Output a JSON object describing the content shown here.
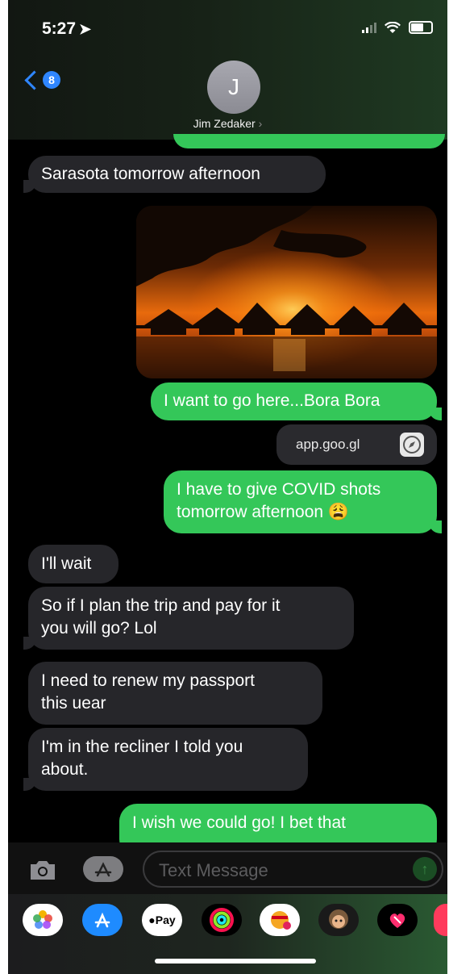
{
  "status_bar": {
    "time": "5:27",
    "location_arrow": "location-arrow-icon"
  },
  "header": {
    "back_badge": "8",
    "avatar_initial": "J",
    "contact_name": "Jim Zedaker"
  },
  "messages": [
    {
      "direction": "incoming",
      "text": "Sarasota tomorrow afternoon"
    },
    {
      "direction": "outgoing",
      "type": "image",
      "alt": ""
    },
    {
      "direction": "outgoing",
      "text": "I want to go here...Bora Bora"
    },
    {
      "direction": "outgoing",
      "type": "link",
      "text": "app.goo.gl"
    },
    {
      "direction": "outgoing",
      "text_line1": "I have to give COVID shots",
      "text_line2": "tomorrow afternoon 😩"
    },
    {
      "direction": "incoming",
      "text": "I'll wait"
    },
    {
      "direction": "incoming",
      "text_line1": "So if I plan the trip and pay for it",
      "text_line2": "you will go?  Lol"
    },
    {
      "direction": "incoming",
      "text_line1": "I need to renew my passport",
      "text_line2": "this uear"
    },
    {
      "direction": "incoming",
      "text_line1": "I'm in the recliner I told you",
      "text_line2": "about."
    },
    {
      "direction": "outgoing",
      "text_line1": "I wish we could go! I bet that"
    }
  ],
  "input": {
    "placeholder": "Text Message"
  },
  "app_drawer": {
    "apps": [
      "photos-icon",
      "app-store-icon",
      "apple-pay-icon",
      "activity-icon",
      "memoji-stickers-icon",
      "memoji-icon",
      "digital-touch-icon"
    ],
    "apple_pay_label": "Pay"
  },
  "colors": {
    "outgoing": "#34c759",
    "incoming": "#26262a",
    "accent": "#2f86ff"
  }
}
